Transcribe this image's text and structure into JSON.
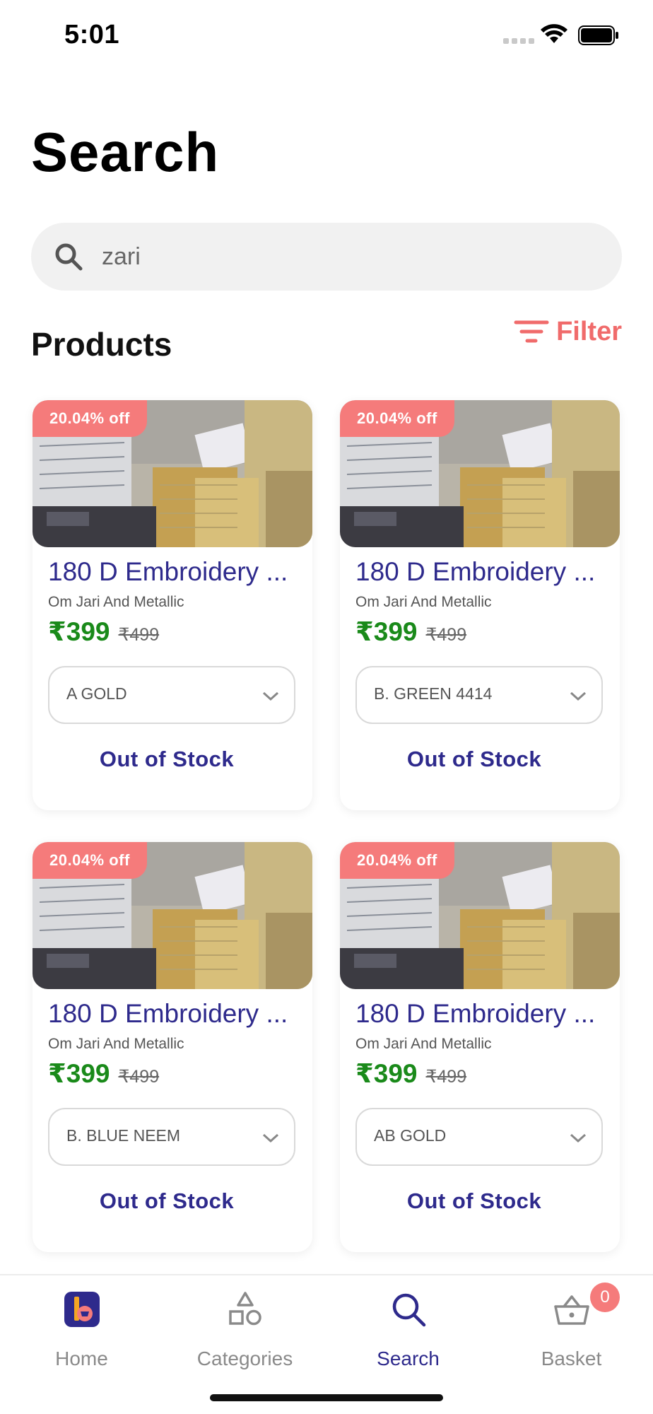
{
  "status_bar": {
    "time": "5:01"
  },
  "header": {
    "title": "Search"
  },
  "search": {
    "value": "zari"
  },
  "products_section": {
    "title": "Products",
    "filter_label": "Filter"
  },
  "products": [
    {
      "discount": "20.04% off",
      "name": "180 D Embroidery ...",
      "brand": "Om Jari And Metallic",
      "price": "₹399",
      "original_price": "₹499",
      "variant": "A GOLD",
      "stock": "Out of Stock"
    },
    {
      "discount": "20.04% off",
      "name": "180 D Embroidery ...",
      "brand": "Om Jari And Metallic",
      "price": "₹399",
      "original_price": "₹499",
      "variant": "B. GREEN 4414",
      "stock": "Out of Stock"
    },
    {
      "discount": "20.04% off",
      "name": "180 D Embroidery ...",
      "brand": "Om Jari And Metallic",
      "price": "₹399",
      "original_price": "₹499",
      "variant": "B. BLUE NEEM",
      "stock": "Out of Stock"
    },
    {
      "discount": "20.04% off",
      "name": "180 D Embroidery ...",
      "brand": "Om Jari And Metallic",
      "price": "₹399",
      "original_price": "₹499",
      "variant": "AB GOLD",
      "stock": "Out of Stock"
    }
  ],
  "bottom_nav": {
    "items": [
      {
        "label": "Home",
        "icon": "home-logo-icon"
      },
      {
        "label": "Categories",
        "icon": "categories-icon"
      },
      {
        "label": "Search",
        "icon": "search-icon",
        "active": true
      },
      {
        "label": "Basket",
        "icon": "basket-icon",
        "badge": "0"
      }
    ]
  },
  "colors": {
    "accent": "#2e2a8c",
    "discount": "#f57b7b",
    "price": "#1a8a1a",
    "filter": "#f06b6b"
  }
}
